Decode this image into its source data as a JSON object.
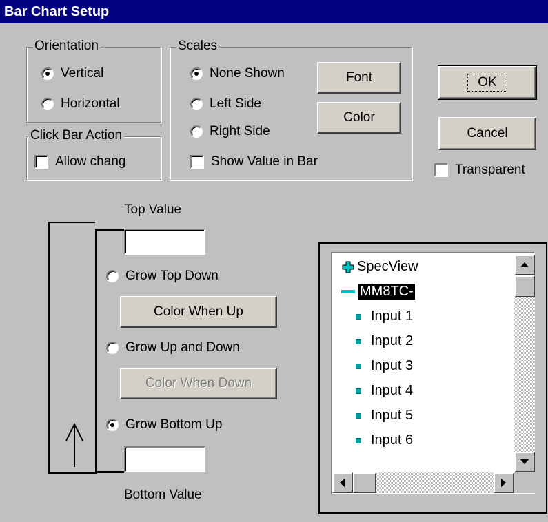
{
  "window": {
    "title": "Bar Chart Setup"
  },
  "orientation": {
    "label": "Orientation",
    "options": [
      "Vertical",
      "Horizontal"
    ],
    "selected": "Vertical"
  },
  "click_bar_action": {
    "label": "Click Bar Action",
    "allow_change_label": "Allow chang",
    "allow_change_checked": false
  },
  "scales": {
    "label": "Scales",
    "options": [
      "None Shown",
      "Left Side",
      "Right Side"
    ],
    "selected": "None Shown",
    "show_value_label": "Show Value in Bar",
    "show_value_checked": false,
    "font_button": "Font",
    "color_button": "Color"
  },
  "buttons": {
    "ok": "OK",
    "cancel": "Cancel"
  },
  "transparent": {
    "label": "Transparent",
    "checked": false
  },
  "bar": {
    "top_value_label": "Top Value",
    "top_value": "",
    "bottom_value_label": "Bottom Value",
    "bottom_value": "",
    "grow_options": [
      "Grow Top Down",
      "Grow Up and Down",
      "Grow Bottom Up"
    ],
    "grow_selected": "Grow Bottom Up",
    "color_when_up": "Color When Up",
    "color_when_down": "Color When Down",
    "color_when_down_enabled": false
  },
  "tree": {
    "root": {
      "label": "SpecView",
      "icon": "plus-icon"
    },
    "device": {
      "label": "MM8TC-",
      "icon": "minus-icon",
      "selected": true
    },
    "inputs": [
      "Input 1",
      "Input 2",
      "Input 3",
      "Input 4",
      "Input 5",
      "Input 6"
    ]
  },
  "colors": {
    "title_bar": "#000080",
    "face": "#c0c0c0",
    "expand_icon": "#00c0c0"
  }
}
